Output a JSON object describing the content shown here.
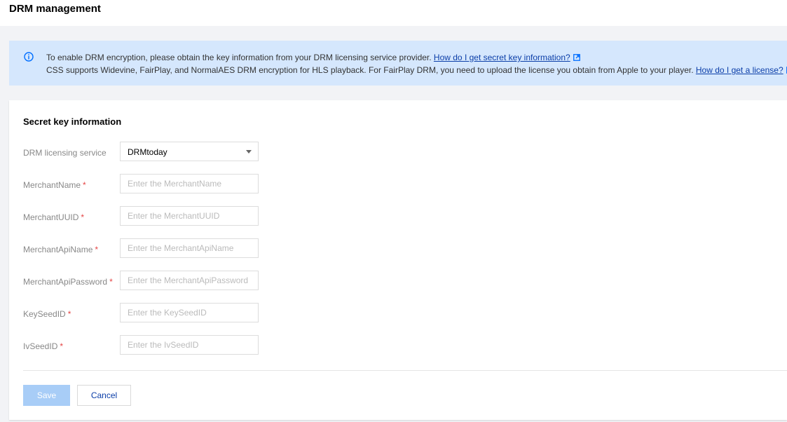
{
  "header": {
    "title": "DRM management"
  },
  "notice": {
    "icon": "info-circle-icon",
    "line1_text": "To enable DRM encryption, please obtain the key information from your DRM licensing service provider. ",
    "line1_link": "How do I get secret key information?",
    "line2_text": "CSS supports Widevine, FairPlay, and NormalAES DRM encryption for HLS playback. For FairPlay DRM, you need to upload the license you obtain from Apple to your player. ",
    "line2_link": "How do I get a license?",
    "link_icon": "external-link-icon",
    "accent_color": "#006eff"
  },
  "form": {
    "section_title": "Secret key information",
    "service": {
      "label": "DRM licensing service",
      "value": "DRMtoday"
    },
    "fields": [
      {
        "label": "MerchantName",
        "placeholder": "Enter the MerchantName",
        "required": "*"
      },
      {
        "label": "MerchantUUID",
        "placeholder": "Enter the MerchantUUID",
        "required": "*"
      },
      {
        "label": "MerchantApiName",
        "placeholder": "Enter the MerchantApiName",
        "required": "*"
      },
      {
        "label": "MerchantApiPassword",
        "placeholder": "Enter the MerchantApiPassword",
        "required": "*"
      },
      {
        "label": "KeySeedID",
        "placeholder": "Enter the KeySeedID",
        "required": "*"
      },
      {
        "label": "IvSeedID",
        "placeholder": "Enter the IvSeedID",
        "required": "*"
      }
    ]
  },
  "actions": {
    "save_label": "Save",
    "cancel_label": "Cancel"
  }
}
